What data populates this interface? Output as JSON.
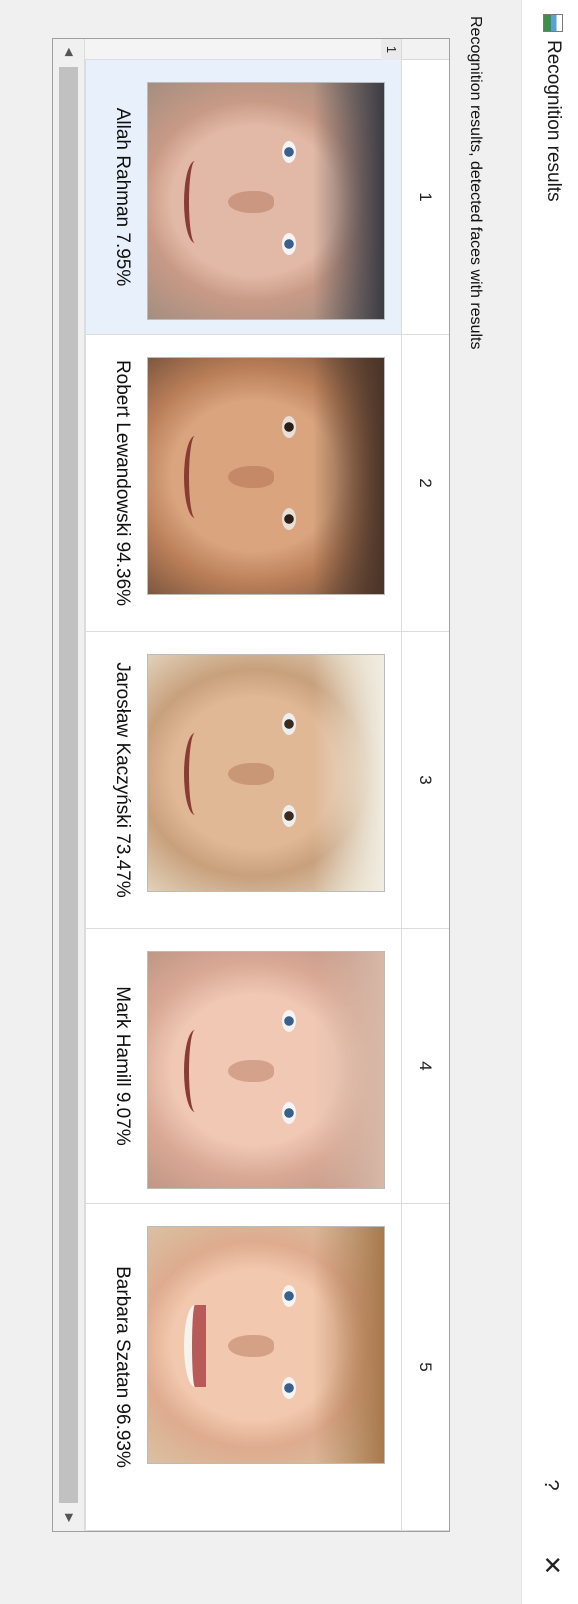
{
  "window": {
    "title": "Recognition results",
    "help_label": "?",
    "close_label": "✕"
  },
  "subtitle": "Recognition results, detected faces with results",
  "grid": {
    "row_header": "1",
    "columns": [
      "1",
      "2",
      "3",
      "4",
      "5"
    ],
    "cells": [
      {
        "label": "Allah Rahman 7.95%",
        "selected": true
      },
      {
        "label": "Robert Lewandowski 94.36%",
        "selected": false
      },
      {
        "label": "Jarosław Kaczyński 73.47%",
        "selected": false
      },
      {
        "label": "Mark Hamill 9.07%",
        "selected": false
      },
      {
        "label": "Barbara Szatan 96.93%",
        "selected": false
      }
    ],
    "scroll_left_label": "◀",
    "scroll_right_label": "▶"
  },
  "colors": {
    "selected_cell": "#e8f0fb",
    "grid_border": "#a0a0a0"
  }
}
